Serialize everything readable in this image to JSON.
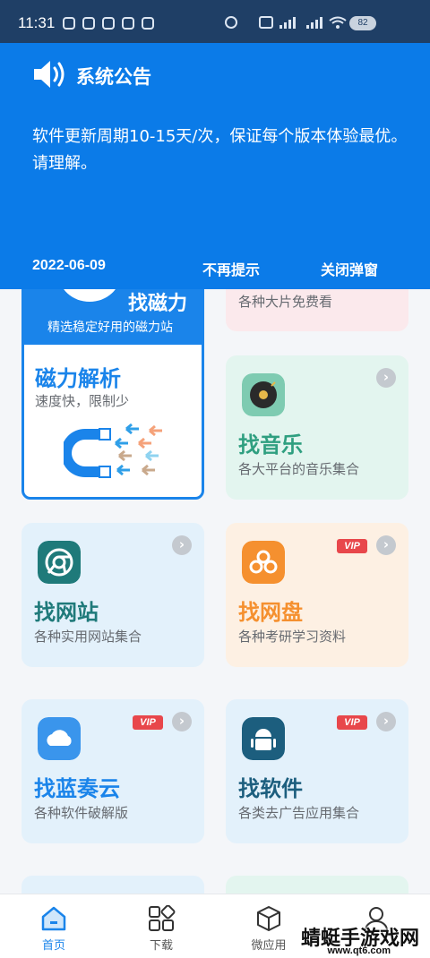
{
  "status_bar": {
    "time": "11:31",
    "battery": "82"
  },
  "notice": {
    "title": "系统公告",
    "body_line1": "软件更新周期10-15天/次，保证每个版本体验最优。",
    "body_line2": "请理解。",
    "date": "2022-06-09",
    "no_more_label": "不再提示",
    "close_label": "关闭弹窗"
  },
  "magnet_card": {
    "header_title": "找磁力",
    "header_subtitle": "精选稳定好用的磁力站",
    "title": "磁力解析",
    "subtitle": "速度快，限制少"
  },
  "cards": {
    "video": {
      "subtitle": "各种大片免费看"
    },
    "music": {
      "title": "找音乐",
      "subtitle": "各大平台的音乐集合",
      "icon": "vinyl-icon"
    },
    "site": {
      "title": "找网站",
      "subtitle": "各种实用网站集合",
      "icon": "chrome-icon"
    },
    "pan": {
      "title": "找网盘",
      "subtitle": "各种考研学习资料",
      "icon": "cloud-drive-icon",
      "badge": "VIP"
    },
    "lanzou": {
      "title": "找蓝奏云",
      "subtitle": "各种软件破解版",
      "icon": "cloud-icon",
      "badge": "VIP"
    },
    "soft": {
      "title": "找软件",
      "subtitle": "各类去广告应用集合",
      "icon": "android-icon",
      "badge": "VIP"
    }
  },
  "colors": {
    "accent": "#1a84ea",
    "notice_bg": "#0b7be8",
    "music_green": "#2f9f80",
    "site_teal": "#1f7a7a",
    "pan_orange": "#f5902f",
    "soft_dark": "#1c5e7e"
  },
  "bottom_nav": {
    "items": [
      {
        "label": "首页",
        "icon": "home-icon"
      },
      {
        "label": "下载",
        "icon": "grid-icon"
      },
      {
        "label": "微应用",
        "icon": "cube-icon"
      },
      {
        "label": "",
        "icon": "user-icon"
      }
    ]
  },
  "watermark": {
    "text": "蜻蜓手游戏网",
    "url": "www.qt6.com"
  }
}
